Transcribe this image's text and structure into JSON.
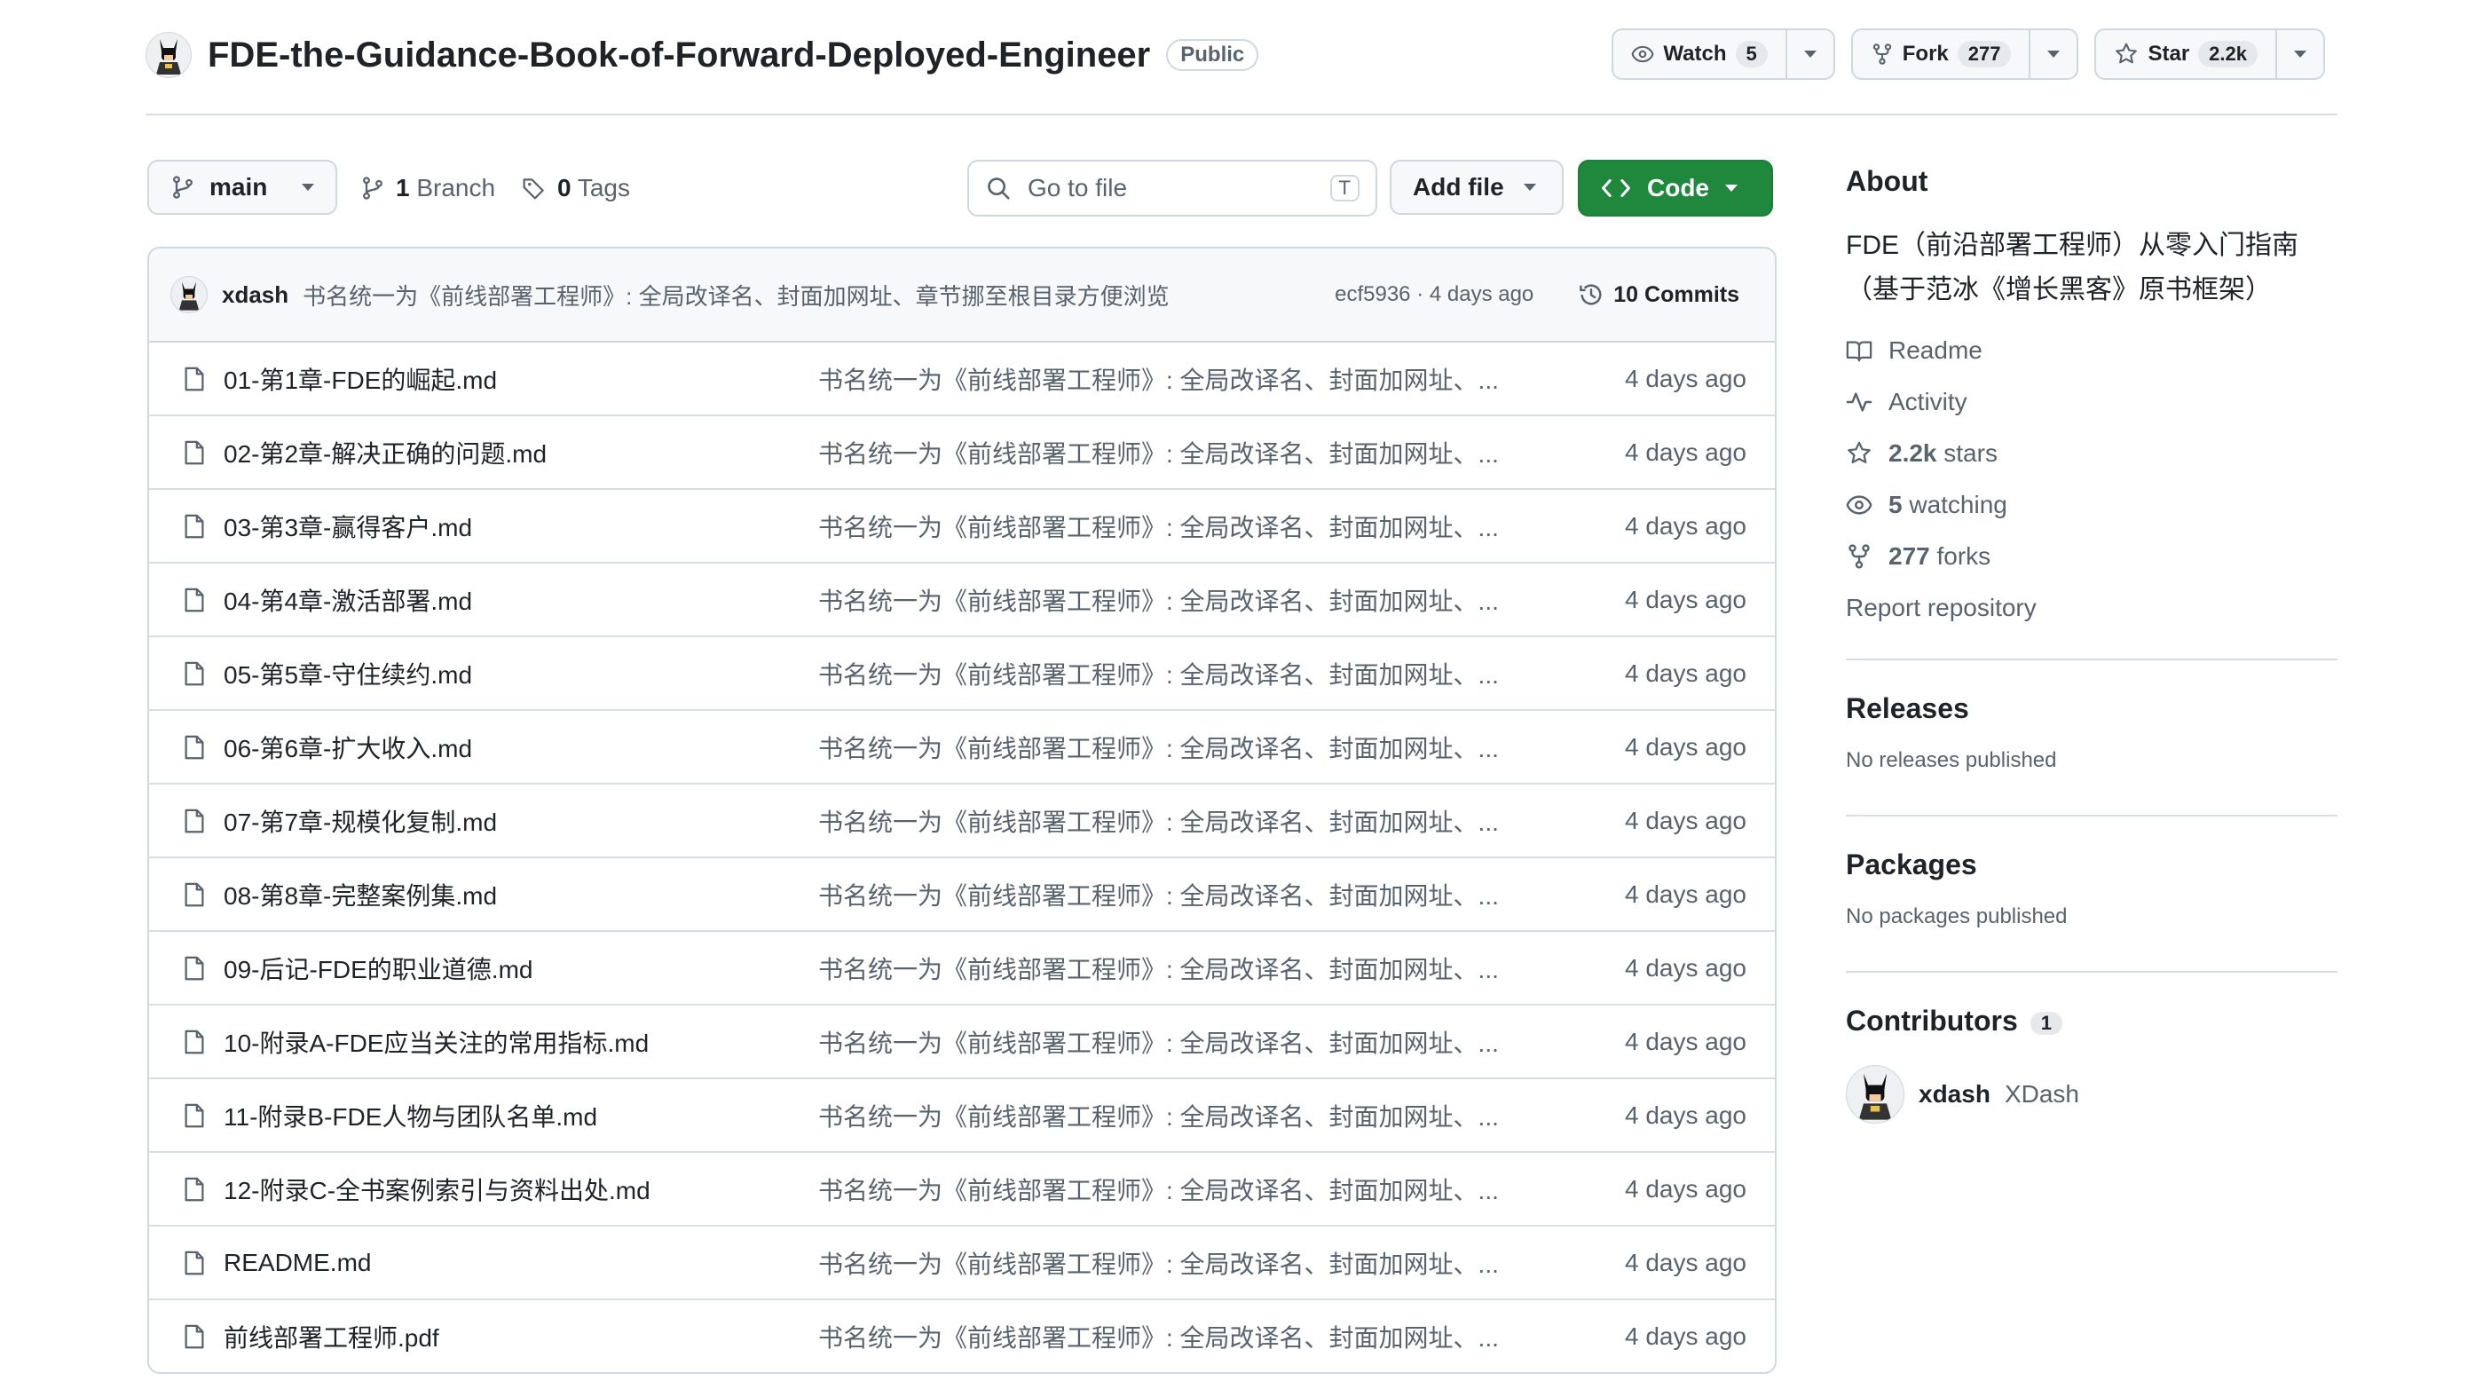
{
  "repo": {
    "name": "FDE-the-Guidance-Book-of-Forward-Deployed-Engineer",
    "visibility": "Public",
    "owner_avatar": "batman-avatar"
  },
  "actions": {
    "watch_label": "Watch",
    "watch_count": "5",
    "fork_label": "Fork",
    "fork_count": "277",
    "star_label": "Star",
    "star_count": "2.2k"
  },
  "toolbar": {
    "branch": "main",
    "branch_count": "1",
    "branch_label": "Branch",
    "tag_count": "0",
    "tag_label": "Tags",
    "search_placeholder": "Go to file",
    "search_shortcut": "T",
    "add_file_label": "Add file",
    "code_label": "Code"
  },
  "latest_commit": {
    "user": "xdash",
    "message": "书名统一为《前线部署工程师》: 全局改译名、封面加网址、章节挪至根目录方便浏览",
    "hash_time": "ecf5936 · 4 days ago",
    "commits_label": "10 Commits"
  },
  "files": [
    {
      "name": "01-第1章-FDE的崛起.md",
      "message": "书名统一为《前线部署工程师》: 全局改译名、封面加网址、...",
      "time": "4 days ago"
    },
    {
      "name": "02-第2章-解决正确的问题.md",
      "message": "书名统一为《前线部署工程师》: 全局改译名、封面加网址、...",
      "time": "4 days ago"
    },
    {
      "name": "03-第3章-赢得客户.md",
      "message": "书名统一为《前线部署工程师》: 全局改译名、封面加网址、...",
      "time": "4 days ago"
    },
    {
      "name": "04-第4章-激活部署.md",
      "message": "书名统一为《前线部署工程师》: 全局改译名、封面加网址、...",
      "time": "4 days ago"
    },
    {
      "name": "05-第5章-守住续约.md",
      "message": "书名统一为《前线部署工程师》: 全局改译名、封面加网址、...",
      "time": "4 days ago"
    },
    {
      "name": "06-第6章-扩大收入.md",
      "message": "书名统一为《前线部署工程师》: 全局改译名、封面加网址、...",
      "time": "4 days ago"
    },
    {
      "name": "07-第7章-规模化复制.md",
      "message": "书名统一为《前线部署工程师》: 全局改译名、封面加网址、...",
      "time": "4 days ago"
    },
    {
      "name": "08-第8章-完整案例集.md",
      "message": "书名统一为《前线部署工程师》: 全局改译名、封面加网址、...",
      "time": "4 days ago"
    },
    {
      "name": "09-后记-FDE的职业道德.md",
      "message": "书名统一为《前线部署工程师》: 全局改译名、封面加网址、...",
      "time": "4 days ago"
    },
    {
      "name": "10-附录A-FDE应当关注的常用指标.md",
      "message": "书名统一为《前线部署工程师》: 全局改译名、封面加网址、...",
      "time": "4 days ago"
    },
    {
      "name": "11-附录B-FDE人物与团队名单.md",
      "message": "书名统一为《前线部署工程师》: 全局改译名、封面加网址、...",
      "time": "4 days ago"
    },
    {
      "name": "12-附录C-全书案例索引与资料出处.md",
      "message": "书名统一为《前线部署工程师》: 全局改译名、封面加网址、...",
      "time": "4 days ago"
    },
    {
      "name": "README.md",
      "message": "书名统一为《前线部署工程师》: 全局改译名、封面加网址、...",
      "time": "4 days ago"
    },
    {
      "name": "前线部署工程师.pdf",
      "message": "书名统一为《前线部署工程师》: 全局改译名、封面加网址、...",
      "time": "4 days ago"
    }
  ],
  "about": {
    "heading": "About",
    "description": "FDE（前沿部署工程师）从零入门指南（基于范冰《增长黑客》原书框架）",
    "readme": "Readme",
    "activity": "Activity",
    "stars_count": "2.2k",
    "stars_label": "stars",
    "watching_count": "5",
    "watching_label": "watching",
    "forks_count": "277",
    "forks_label": "forks",
    "report": "Report repository"
  },
  "releases": {
    "heading": "Releases",
    "text": "No releases published"
  },
  "packages": {
    "heading": "Packages",
    "text": "No packages published"
  },
  "contributors": {
    "heading": "Contributors",
    "count": "1",
    "login": "xdash",
    "name": "XDash"
  },
  "colors": {
    "code_button": "#1f883d",
    "border": "#d0d7de",
    "muted": "#59636e"
  }
}
